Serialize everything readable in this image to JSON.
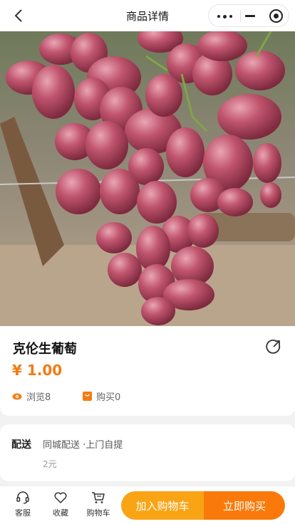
{
  "nav": {
    "title": "商品详情"
  },
  "product": {
    "name": "克伦生葡萄",
    "price": "¥ 1.00",
    "views": "浏览8",
    "purchases": "购买0"
  },
  "delivery": {
    "label": "配送",
    "methods": "同城配送 ·上门自提",
    "fee": "2元"
  },
  "bottom_bar": {
    "service": "客服",
    "favorite": "收藏",
    "cart": "购物车",
    "add_to_cart": "加入购物车",
    "buy_now": "立即购买"
  },
  "colors": {
    "accent_orange": "#f97a0b",
    "accent_yellow": "#f9a415",
    "price": "#f37b12"
  }
}
